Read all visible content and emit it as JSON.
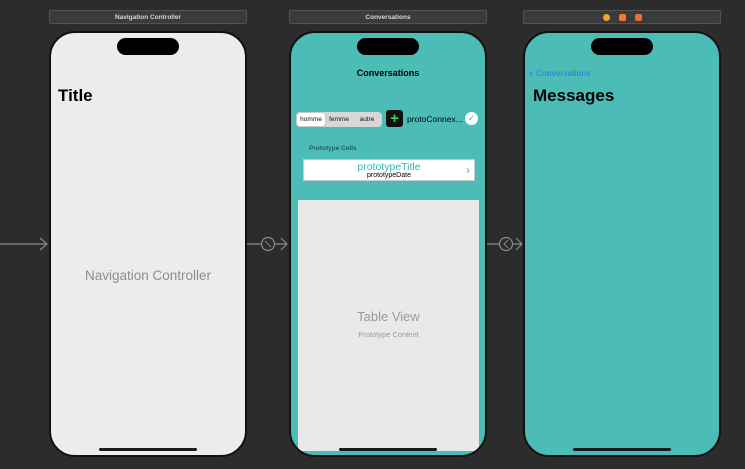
{
  "scenes": {
    "nav_controller": {
      "bar_title": "Navigation Controller",
      "large_title": "Title",
      "center_label": "Navigation Controller"
    },
    "conversations": {
      "bar_title": "Conversations",
      "nav_title": "Conversations",
      "segmented": [
        "homme",
        "femme",
        "autre"
      ],
      "selected_segment": "homme",
      "add_icon": "plus-icon",
      "proto_label": "protoConnex...",
      "cells_header": "Prototype Cells",
      "cell_title": "prototypeTitle",
      "cell_date": "prototypeDate",
      "table_title": "Table View",
      "table_subtitle": "Prototype Content"
    },
    "messages": {
      "bar_icons": [
        "view-controller-icon",
        "first-responder-icon",
        "exit-icon"
      ],
      "back_label": "Conversations",
      "large_title": "Messages"
    }
  },
  "colors": {
    "canvas": "#2c2c2c",
    "teal": "#4bbdb6",
    "link_blue": "#1f7cf0",
    "add_green": "#22e04a"
  }
}
